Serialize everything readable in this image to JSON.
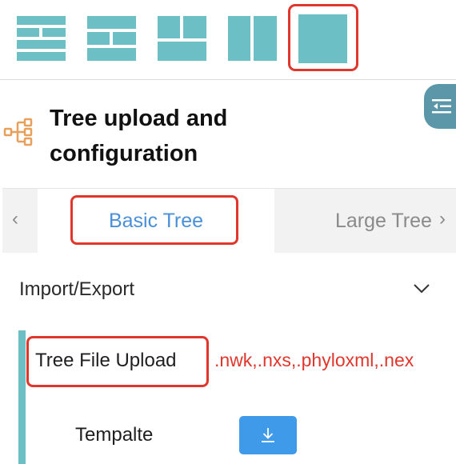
{
  "toolbar": {
    "layouts": [
      {
        "name": "layout-four-rows",
        "selected": false
      },
      {
        "name": "layout-three-rows",
        "selected": false
      },
      {
        "name": "layout-split-grid",
        "selected": false
      },
      {
        "name": "layout-two-columns",
        "selected": false
      },
      {
        "name": "layout-single",
        "selected": true
      }
    ],
    "color": "#6cbfc4"
  },
  "panel": {
    "icon": "tree-structure-icon",
    "icon_color": "#e8a05a",
    "title": "Tree upload and configuration",
    "collapse_icon": "collapse-panel-icon"
  },
  "tabs": {
    "items": [
      "Basic Tree",
      "Large Tree"
    ],
    "active_index": 0,
    "active_color": "#4a90d9"
  },
  "section": {
    "title": "Import/Export",
    "expanded": true,
    "fields": {
      "upload_label": "Tree File Upload",
      "formats": ".nwk,.nxs,.phyloxml,.nex",
      "template_label": "Tempalte",
      "download_icon": "download-icon"
    }
  },
  "colors": {
    "highlight": "#e0362c",
    "accent": "#6cbfc4",
    "button": "#3f9aea"
  }
}
